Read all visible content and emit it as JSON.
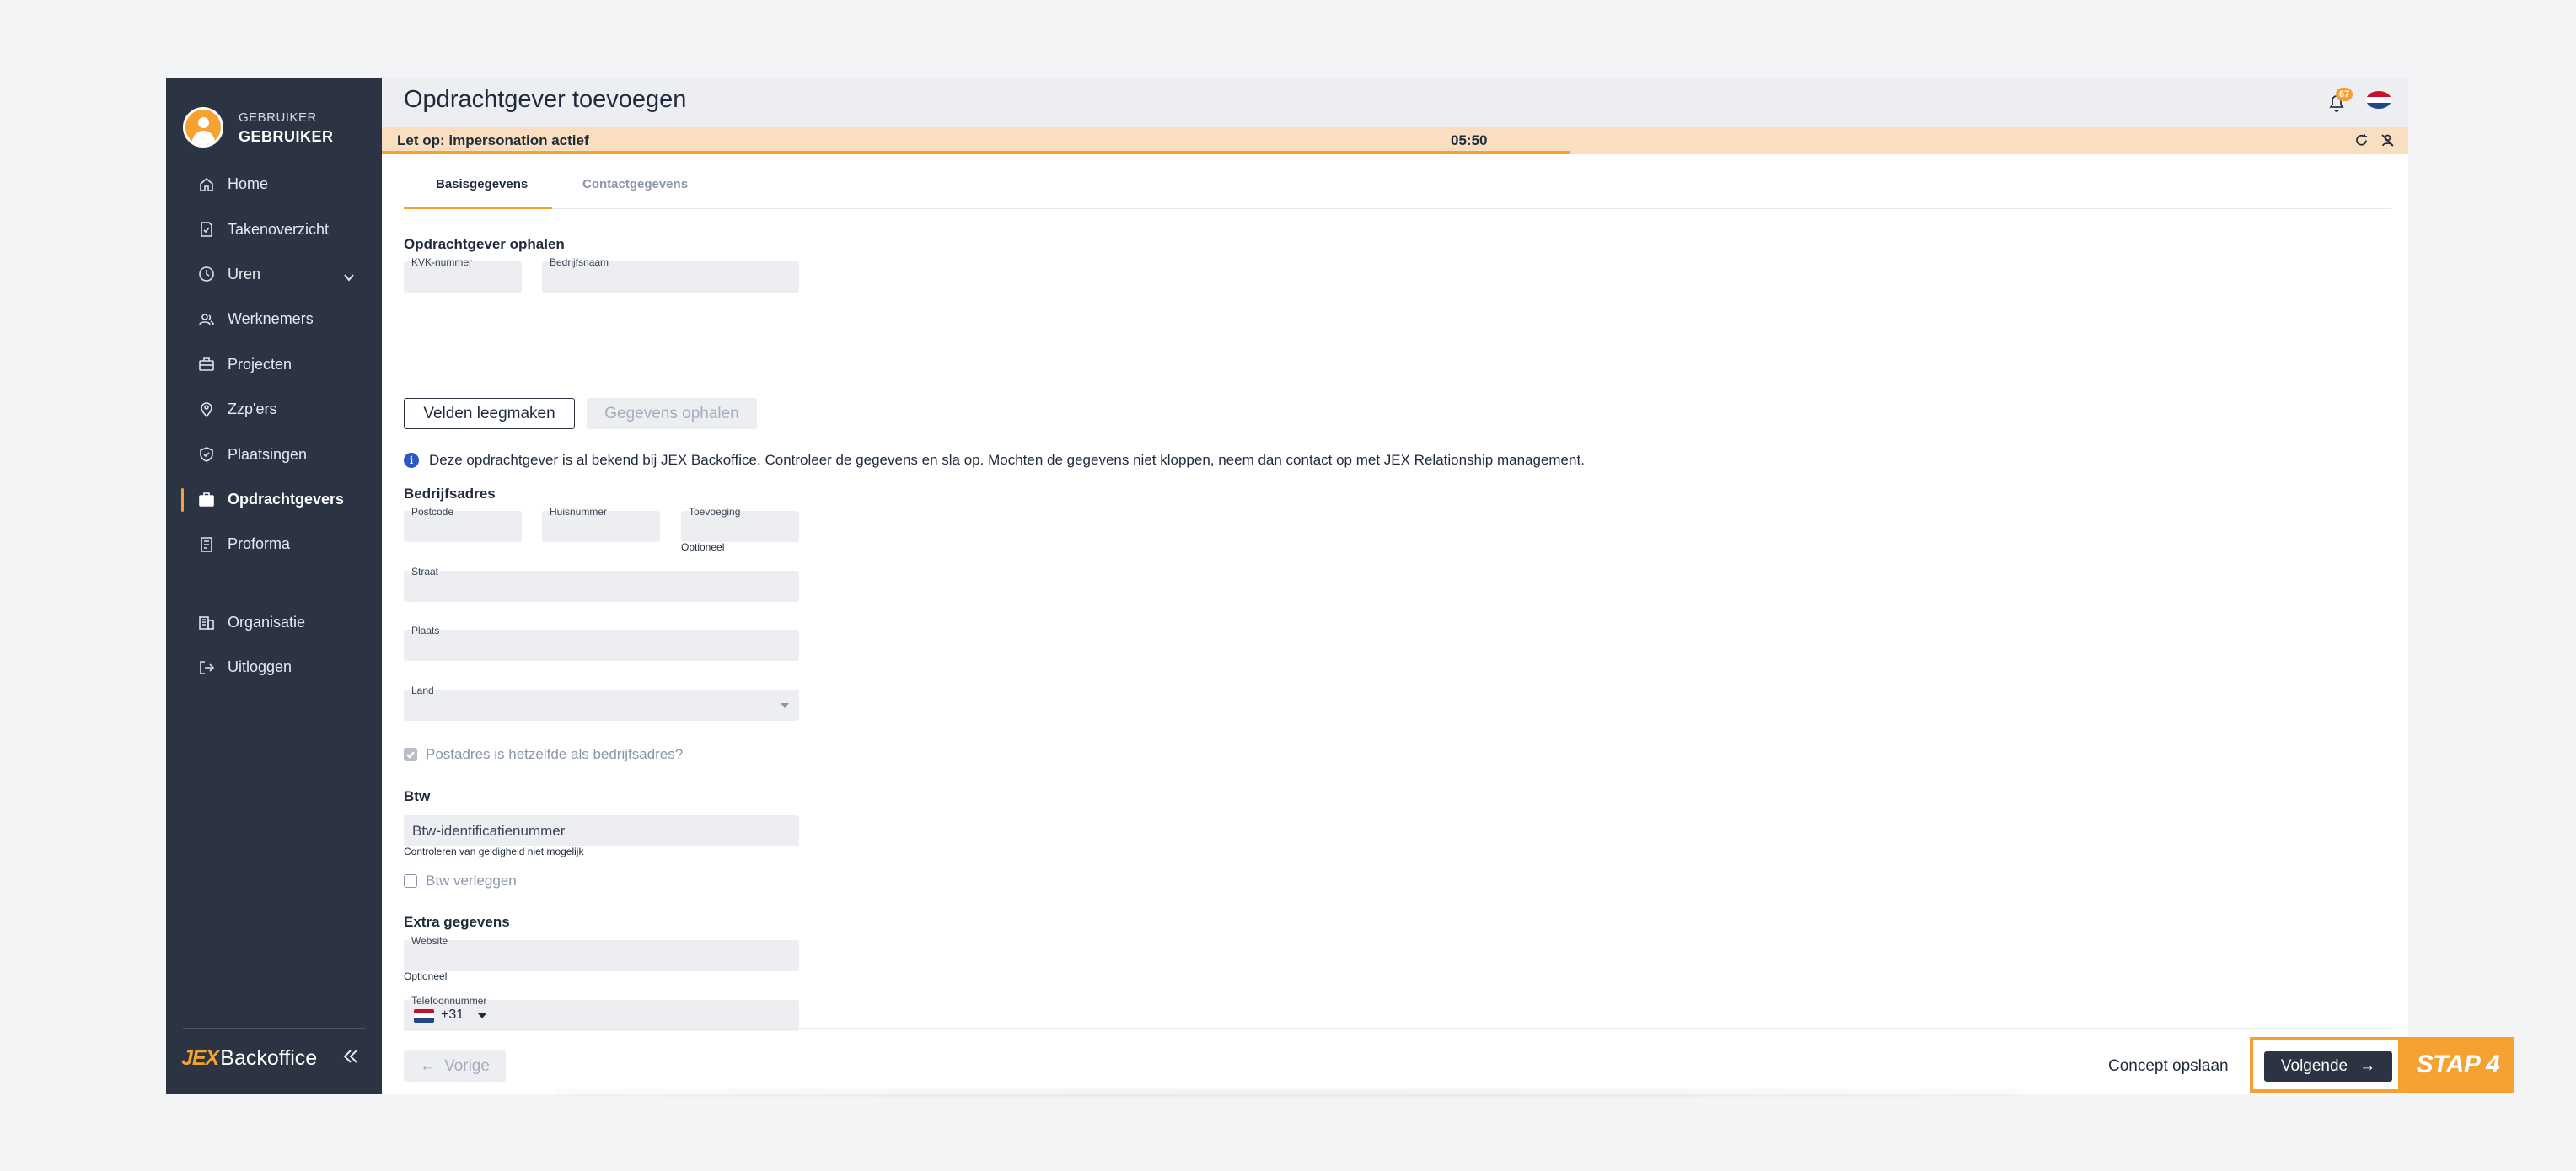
{
  "user": {
    "role": "GEBRUIKER",
    "name": "GEBRUIKER"
  },
  "sidebar": {
    "items": [
      {
        "label": "Home",
        "icon": "home-icon"
      },
      {
        "label": "Takenoverzicht",
        "icon": "task-icon"
      },
      {
        "label": "Uren",
        "icon": "clock-icon"
      },
      {
        "label": "Werknemers",
        "icon": "users-icon"
      },
      {
        "label": "Projecten",
        "icon": "briefcase-icon"
      },
      {
        "label": "Zzp'ers",
        "icon": "location-person-icon"
      },
      {
        "label": "Plaatsingen",
        "icon": "shield-check-icon"
      },
      {
        "label": "Opdrachtgevers",
        "icon": "bag-icon"
      },
      {
        "label": "Proforma",
        "icon": "receipt-icon"
      }
    ],
    "secondary": [
      {
        "label": "Organisatie",
        "icon": "building-icon"
      },
      {
        "label": "Uitloggen",
        "icon": "logout-icon"
      }
    ],
    "active": "Opdrachtgevers",
    "brand_jex": "JEX",
    "brand_name": "Backoffice"
  },
  "header": {
    "title": "Opdrachtgever toevoegen",
    "notification_count": "67"
  },
  "banner": {
    "text": "Let op: impersonation actief",
    "timer": "05:50",
    "progress": 0.586
  },
  "tabs": [
    {
      "label": "Basisgegevens"
    },
    {
      "label": "Contactgegevens"
    }
  ],
  "form": {
    "fetch_section": "Opdrachtgever ophalen",
    "kvk_label": "KVK-nummer",
    "company_label": "Bedrijfsnaam",
    "clear_button": "Velden leegmaken",
    "fetch_button": "Gegevens ophalen",
    "info_text": "Deze opdrachtgever is al bekend bij JEX Backoffice. Controleer de gegevens en sla op. Mochten de gegevens niet kloppen, neem dan contact op met JEX Relationship management.",
    "address_section": "Bedrijfsadres",
    "postcode_label": "Postcode",
    "housenumber_label": "Huisnummer",
    "addition_label": "Toevoeging",
    "optional_hint": "Optioneel",
    "street_label": "Straat",
    "city_label": "Plaats",
    "country_label": "Land",
    "postal_same_label": "Postadres is hetzelfde als bedrijfsadres?",
    "vat_section": "Btw",
    "vat_value": "Btw-identificatienummer",
    "vat_hint": "Controleren van geldigheid niet mogelijk",
    "vat_shift_label": "Btw verleggen",
    "extra_section": "Extra gegevens",
    "website_label": "Website",
    "website_hint": "Optioneel",
    "phone_label": "Telefoonnummer",
    "phone_code": "+31"
  },
  "footer": {
    "prev_button": "Vorige",
    "concept_button": "Concept opslaan",
    "next_button": "Volgende"
  },
  "annotation": {
    "step_label": "STAP 4"
  },
  "colors": {
    "accent": "#f5a233",
    "sidebar": "#2c3444",
    "banner": "#f9dfc0",
    "field": "#eceef2"
  }
}
